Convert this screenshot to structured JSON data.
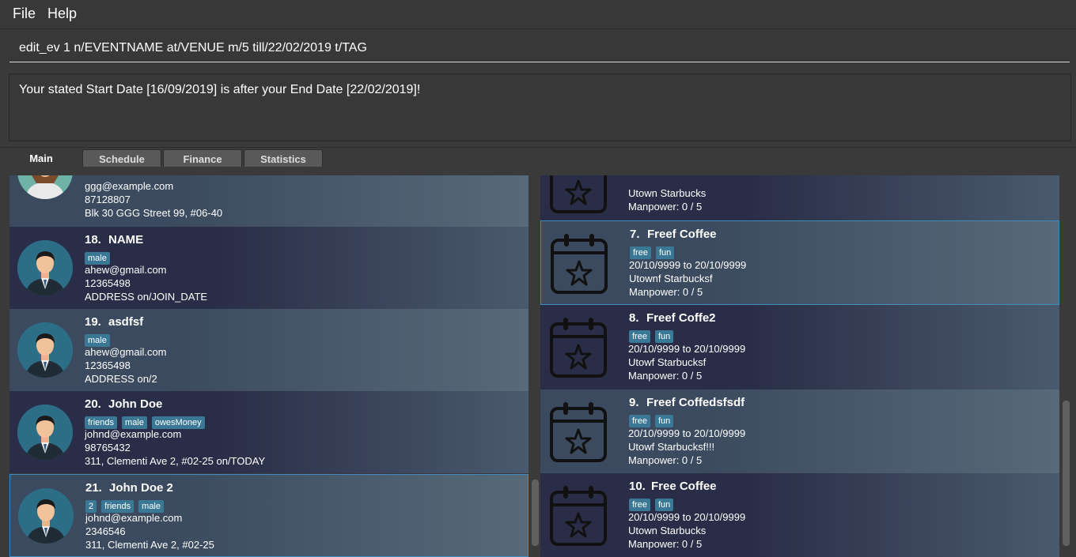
{
  "menu": {
    "file": "File",
    "help": "Help"
  },
  "command_box": {
    "value": "edit_ev 1 n/EVENTNAME at/VENUE m/5 till/22/02/2019 t/TAG"
  },
  "result": {
    "text": "Your stated Start Date [16/09/2019] is after your End Date [22/02/2019]!"
  },
  "tabs": [
    {
      "label": "Main"
    },
    {
      "label": "Schedule"
    },
    {
      "label": "Finance"
    },
    {
      "label": "Statistics"
    }
  ],
  "persons": [
    {
      "index": "",
      "name": "",
      "tags": [],
      "email": "ggg@example.com",
      "phone": "87128807",
      "address": "Blk 30 GGG Street 99, #06-40"
    },
    {
      "index": "18.",
      "name": "NAME",
      "tags": [
        "male"
      ],
      "email": "ahew@gmail.com",
      "phone": "12365498",
      "address": "ADDRESS on/JOIN_DATE"
    },
    {
      "index": "19.",
      "name": "asdfsf",
      "tags": [
        "male"
      ],
      "email": "ahew@gmail.com",
      "phone": "12365498",
      "address": "ADDRESS on/2"
    },
    {
      "index": "20.",
      "name": "John Doe",
      "tags": [
        "friends",
        "male",
        "owesMoney"
      ],
      "email": "johnd@example.com",
      "phone": "98765432",
      "address": "311, Clementi Ave 2, #02-25 on/TODAY"
    },
    {
      "index": "21.",
      "name": "John Doe 2",
      "tags": [
        "2",
        "friends",
        "male"
      ],
      "email": "johnd@example.com",
      "phone": "2346546",
      "address": "311, Clementi Ave 2, #02-25"
    }
  ],
  "events": [
    {
      "index": "",
      "name": "",
      "tags": [],
      "dates": "",
      "venue": "Utown Starbucks",
      "manpower": "Manpower: 0 / 5"
    },
    {
      "index": "7.",
      "name": "Freef Coffee",
      "tags": [
        "free",
        "fun"
      ],
      "dates": "20/10/9999 to 20/10/9999",
      "venue": "Utownf Starbucksf",
      "manpower": "Manpower: 0 / 5"
    },
    {
      "index": "8.",
      "name": "Freef Coffe2",
      "tags": [
        "free",
        "fun"
      ],
      "dates": "20/10/9999 to 20/10/9999",
      "venue": "Utowf Starbucksf",
      "manpower": "Manpower: 0 / 5"
    },
    {
      "index": "9.",
      "name": "Freef Coffedsfsdf",
      "tags": [
        "free",
        "fun"
      ],
      "dates": "20/10/9999 to 20/10/9999",
      "venue": "Utowf Starbucksf!!!",
      "manpower": "Manpower: 0 / 5"
    },
    {
      "index": "10.",
      "name": "Free Coffee",
      "tags": [
        "free",
        "fun"
      ],
      "dates": "20/10/9999 to 20/10/9999",
      "venue": "Utown Starbucks",
      "manpower": "Manpower: 0 / 5"
    }
  ],
  "colors": {
    "background": "#3a3a3a",
    "tag": "#3b7895",
    "avatar": "#2d6e87",
    "selected_border": "#3f8cbf"
  }
}
